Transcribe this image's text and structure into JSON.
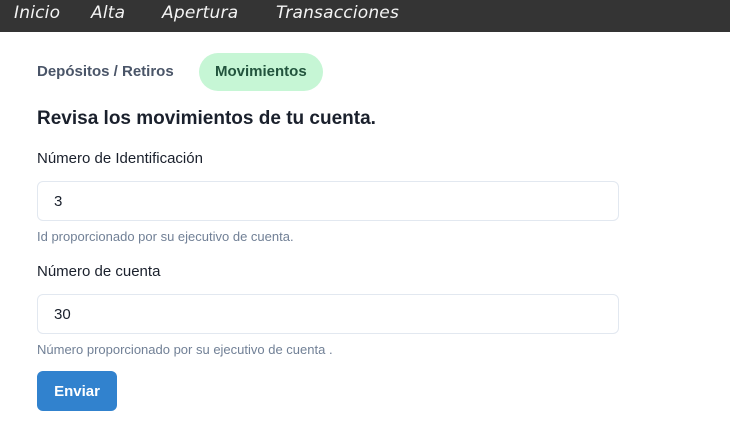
{
  "nav": {
    "items": [
      {
        "label": "Inicio"
      },
      {
        "label": "Alta"
      },
      {
        "label": "Apertura"
      },
      {
        "label": "Transacciones"
      }
    ]
  },
  "tabs": {
    "items": [
      {
        "label": "Depósitos / Retiros",
        "active": false
      },
      {
        "label": "Movimientos",
        "active": true
      }
    ]
  },
  "form": {
    "heading": "Revisa los movimientos de tu cuenta.",
    "id_label": "Número de Identificación",
    "id_value": "3",
    "id_helper": "Id proporcionado por su ejecutivo de cuenta.",
    "account_label": "Número de cuenta",
    "account_value": "30",
    "account_helper": "Número proporcionado por su ejecutivo de cuenta .",
    "submit_label": "Enviar"
  },
  "colors": {
    "topbar": "#343434",
    "active_tab_bg": "#c6f6d5",
    "active_tab_text": "#22543d",
    "button": "#3182ce"
  }
}
